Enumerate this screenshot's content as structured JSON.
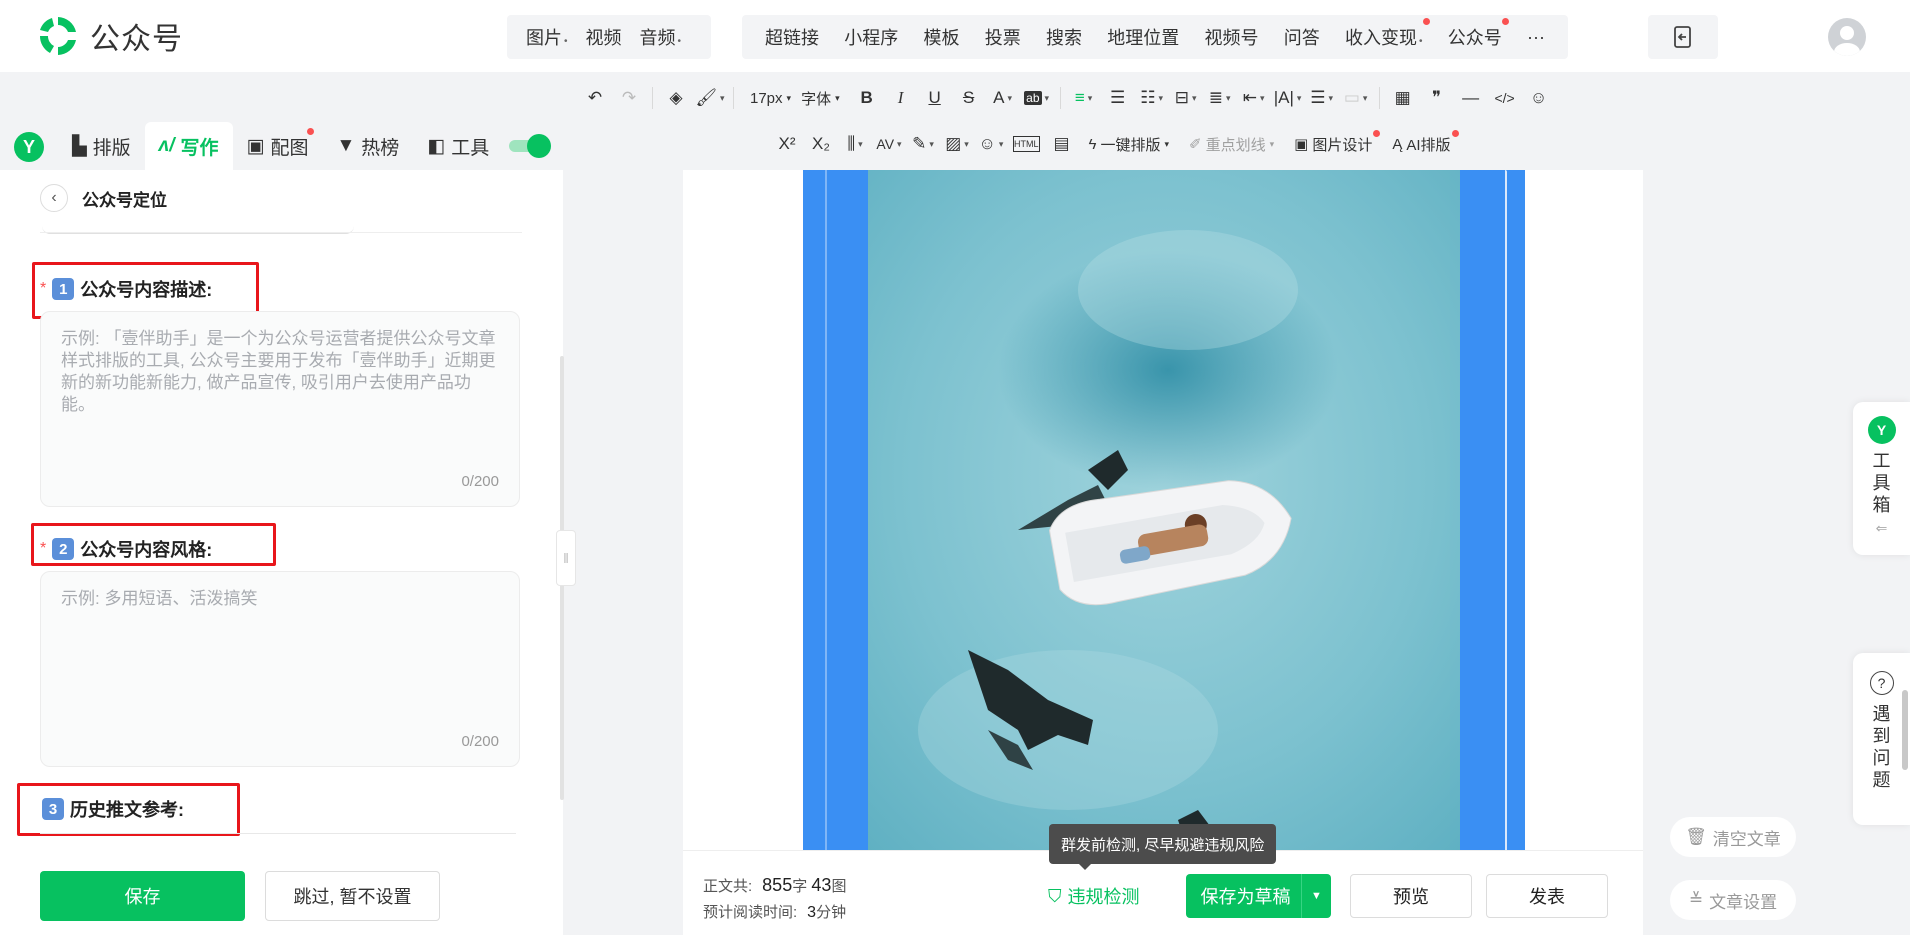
{
  "header": {
    "brand_name": "公众号",
    "group1": [
      {
        "label": "图片",
        "dropdown": true
      },
      {
        "label": "视频",
        "dropdown": false
      },
      {
        "label": "音频",
        "dropdown": true
      }
    ],
    "group2": [
      {
        "label": "超链接",
        "dropdown": false,
        "dot": false
      },
      {
        "label": "小程序",
        "dropdown": false,
        "dot": false
      },
      {
        "label": "模板",
        "dropdown": false,
        "dot": false
      },
      {
        "label": "投票",
        "dropdown": false,
        "dot": false
      },
      {
        "label": "搜索",
        "dropdown": false,
        "dot": false
      },
      {
        "label": "地理位置",
        "dropdown": false,
        "dot": false
      },
      {
        "label": "视频号",
        "dropdown": false,
        "dot": false
      },
      {
        "label": "问答",
        "dropdown": false,
        "dot": false
      },
      {
        "label": "收入变现",
        "dropdown": true,
        "dot": true
      },
      {
        "label": "公众号",
        "dropdown": false,
        "dot": true
      }
    ],
    "more_label": "···"
  },
  "toolbar": {
    "font_size": "17px",
    "font_family": "字体",
    "one_click_layout": "一键排版",
    "highlight": "重点划线",
    "image_design": "图片设计",
    "ai_layout": "AI排版"
  },
  "nav_tabs": [
    {
      "label": "排版",
      "icon": "layout-icon",
      "active": false,
      "dot": false
    },
    {
      "label": "写作",
      "icon": "write-icon",
      "active": true,
      "dot": false
    },
    {
      "label": "配图",
      "icon": "image-icon",
      "active": false,
      "dot": true
    },
    {
      "label": "热榜",
      "icon": "bookmark-icon",
      "active": false,
      "dot": false
    },
    {
      "label": "工具",
      "icon": "cube-icon",
      "active": false,
      "dot": false
    }
  ],
  "left_panel": {
    "title": "公众号定位",
    "field1": {
      "number": "1",
      "label": "公众号内容描述:",
      "placeholder": "示例: 「壹伴助手」是一个为公众号运营者提供公众号文章样式排版的工具, 公众号主要用于发布「壹伴助手」近期更新的新功能新能力, 做产品宣传, 吸引用户去使用产品功能。",
      "count": "0/200"
    },
    "field2": {
      "number": "2",
      "label": "公众号内容风格:",
      "placeholder": "示例: 多用短语、活泼搞笑",
      "count": "0/200"
    },
    "field3": {
      "number": "3",
      "label": "历史推文参考:"
    },
    "save_label": "保存",
    "skip_label": "跳过, 暂不设置"
  },
  "status": {
    "body_label": "正文共:",
    "char_count": "855",
    "char_unit": "字",
    "img_count": "43",
    "img_unit": "图",
    "read_label": "预计阅读时间:",
    "read_time": "3",
    "read_unit": "分钟",
    "check_label": "违规检测",
    "tooltip": "群发前检测, 尽早规避违规风险",
    "draft_label": "保存为草稿",
    "preview_label": "预览",
    "publish_label": "发表"
  },
  "side": {
    "toolbox": [
      "工",
      "具",
      "箱"
    ],
    "help": [
      "遇",
      "到",
      "问",
      "题"
    ],
    "clear_label": "清空文章",
    "settings_label": "文章设置"
  },
  "colors": {
    "brand_green": "#07c160",
    "alert_red": "#e8161b",
    "frame_blue": "#3a8ff3"
  }
}
